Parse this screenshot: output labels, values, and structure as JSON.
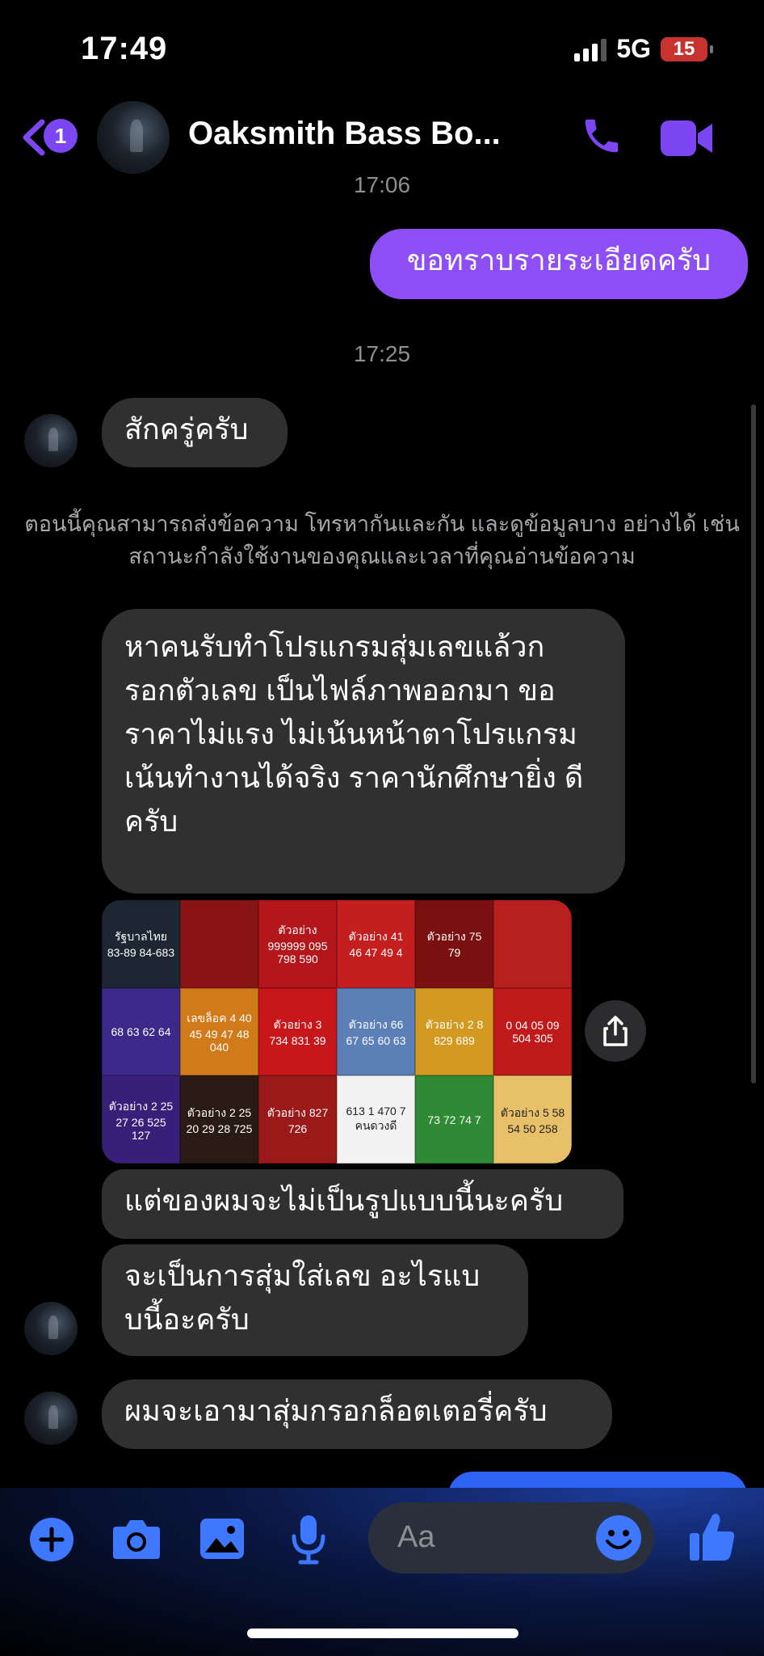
{
  "status": {
    "time": "17:49",
    "network": "5G",
    "battery": "15"
  },
  "header": {
    "back_badge": "1",
    "contact_name": "Oaksmith Bass Bo..."
  },
  "conversation": {
    "time_top": "17:06",
    "msg_out_1": "ขอทราบรายระเอียดครับ",
    "time_2": "17:25",
    "msg_in_1": "สักครู่ครับ",
    "notice": "ตอนนี้คุณสามารถส่งข้อความ โทรหากันและกัน และดูข้อมูลบาง อย่างได้ เช่น สถานะกำลังใช้งานของคุณและเวลาที่คุณอ่านข้อความ",
    "msg_in_2": "หาคนรับทำโปรแกรมสุ่มเลขแล้วก รอกตัวเลข เป็นไฟล์ภาพออกมา ขอราคาไม่แรง ไม่เน้นหน้าตาโปรแกรม เน้นทำงานได้จริง ราคานักศึกษายิ่ง ดีครับ",
    "msg_in_3": "แต่ของผมจะไม่เป็นรูปแบบนี้นะครับ",
    "msg_in_4": "จะเป็นการสุ่มใส่เลข อะไรแบ บนี้อะครับ",
    "msg_in_5": "ผมจะเอามาสุ่มกรอกล็อตเตอรี่ครับ",
    "image_tiles": [
      {
        "label": "รัฐบาลไทย 83-89 84-683",
        "color": "#1c2733"
      },
      {
        "label": "",
        "color": "#8a1414"
      },
      {
        "label": "ตัวอย่าง 999999 095 798 590",
        "color": "#b3171b"
      },
      {
        "label": "ตัวอย่าง 41 46 47 49 4",
        "color": "#c41e1e"
      },
      {
        "label": "ตัวอย่าง 75 79",
        "color": "#7a1010"
      },
      {
        "label": "",
        "color": "#b82020"
      },
      {
        "label": "68 63 62 64",
        "color": "#3b2a8a"
      },
      {
        "label": "เลขล็อค 4 40 45 49 47 48 040",
        "color": "#d07a1a"
      },
      {
        "label": "ตัวอย่าง 3 734 831 39",
        "color": "#c8171b"
      },
      {
        "label": "ตัวอย่าง 66 67 65 60 63",
        "color": "#5c7fb8"
      },
      {
        "label": "ตัวอย่าง 2 8 829 689",
        "color": "#d39a22"
      },
      {
        "label": "0 04 05 09 504 305",
        "color": "#c01a1a"
      },
      {
        "label": "ตัวอย่าง 2 25 27 26 525 127",
        "color": "#3a1f7a"
      },
      {
        "label": "ตัวอย่าง 2 25 20 29 28 725",
        "color": "#2a1a14"
      },
      {
        "label": "ตัวอย่าง 827 726",
        "color": "#9a1a1a"
      },
      {
        "label": "613 1 470 7 คนดวงดี",
        "color": "#f2f2f2"
      },
      {
        "label": "73 72 74 7",
        "color": "#2e8a35"
      },
      {
        "label": "ตัวอย่าง 5 58 54 50 258",
        "color": "#e8c06a"
      }
    ]
  },
  "composer": {
    "placeholder": "Aa"
  },
  "colors": {
    "accent": "#8e4ef5",
    "icons": "#7c46f2",
    "composer_icons": "#3d78ff"
  },
  "icons": [
    "back-chevron-icon",
    "phone-icon",
    "video-camera-icon",
    "share-icon",
    "plus-icon",
    "camera-icon",
    "gallery-icon",
    "microphone-icon",
    "emoji-icon",
    "thumbs-up-icon"
  ]
}
